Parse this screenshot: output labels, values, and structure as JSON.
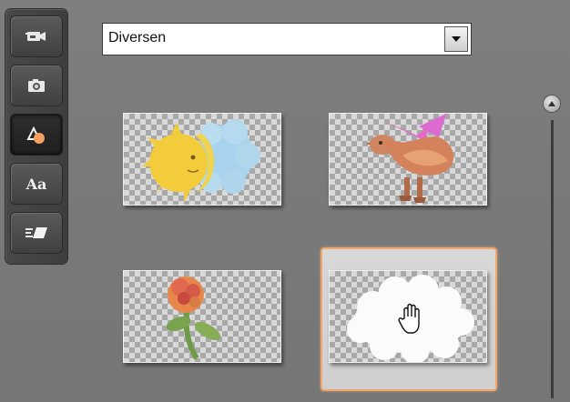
{
  "toolbar": {
    "tools": [
      {
        "icon": "video-camera-icon"
      },
      {
        "icon": "photo-camera-icon"
      },
      {
        "icon": "shapes-icon",
        "active": true
      },
      {
        "icon": "text-icon",
        "glyph": "Aa"
      },
      {
        "icon": "transition-icon"
      }
    ]
  },
  "category_select": {
    "selected": "Diversen"
  },
  "thumbnails": [
    {
      "icon": "sun-moon-cloud-clipart-icon",
      "selected": false
    },
    {
      "icon": "bird-clipart-icon",
      "selected": false
    },
    {
      "icon": "flower-clipart-icon",
      "selected": false
    },
    {
      "icon": "cloud-clipart-icon",
      "selected": true
    }
  ],
  "colors": {
    "background": "#7a7a7a",
    "selection_border": "#f0a86a",
    "toolbar": "#444444"
  }
}
